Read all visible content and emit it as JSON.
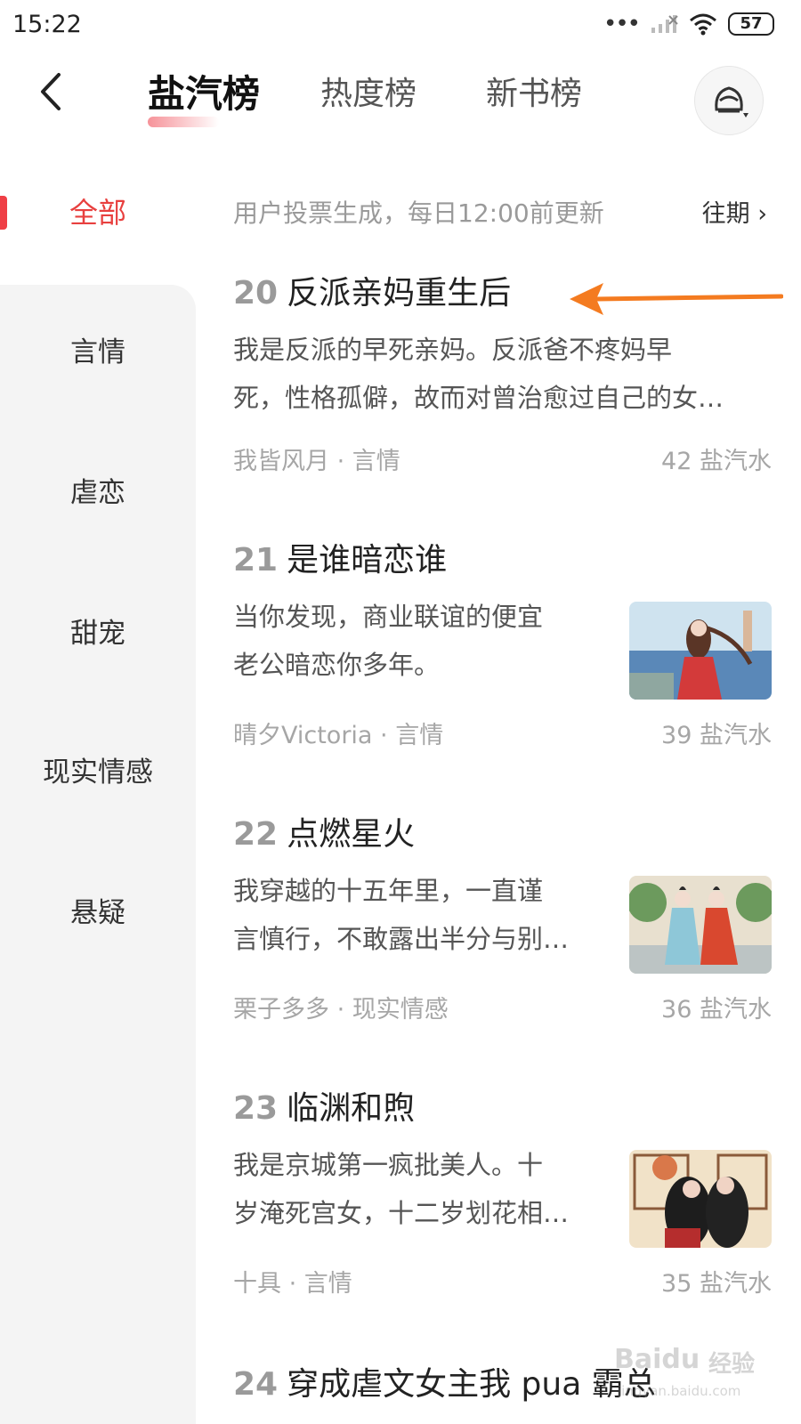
{
  "status": {
    "time": "15:22",
    "battery": "57"
  },
  "header": {
    "tabs": [
      {
        "label": "盐汽榜",
        "active": true
      },
      {
        "label": "热度榜",
        "active": false
      },
      {
        "label": "新书榜",
        "active": false
      }
    ]
  },
  "sidebar": {
    "items": [
      {
        "label": "全部",
        "active": true
      },
      {
        "label": "言情"
      },
      {
        "label": "虐恋"
      },
      {
        "label": "甜宠"
      },
      {
        "label": "现实情感"
      },
      {
        "label": "悬疑"
      }
    ]
  },
  "info": {
    "text": "用户投票生成，每日12:00前更新",
    "history": "往期 ›"
  },
  "books": [
    {
      "rank": "20",
      "title": "反派亲妈重生后",
      "desc_lines": [
        "我是反派的早死亲妈。反派爸不疼妈早",
        "死，性格孤僻，故而对曾治愈过自己的女…"
      ],
      "meta": "我皆风月 · 言情",
      "score": "42 盐汽水"
    },
    {
      "rank": "21",
      "title": "是谁暗恋谁",
      "desc_lines": [
        "当你发现，商业联谊的便宜",
        "老公暗恋你多年。"
      ],
      "meta": "晴夕Victoria · 言情",
      "score": "39 盐汽水"
    },
    {
      "rank": "22",
      "title": "点燃星火",
      "desc_lines": [
        "我穿越的十五年里，一直谨",
        "言慎行，不敢露出半分与别…"
      ],
      "meta": "栗子多多 · 现实情感",
      "score": "36 盐汽水"
    },
    {
      "rank": "23",
      "title": "临渊和煦",
      "desc_lines": [
        "我是京城第一疯批美人。十",
        "岁淹死宫女，十二岁划花相…"
      ],
      "meta": "十具 · 言情",
      "score": "35 盐汽水"
    },
    {
      "rank": "24",
      "title": "穿成虐文女主我 pua 霸总"
    }
  ],
  "watermark": {
    "brand": "Baidu",
    "cn": "经验",
    "url": "jingyan.baidu.com"
  },
  "colors": {
    "accent": "#e8403f",
    "arrow": "#f47b20",
    "sidebar_bg": "#f4f4f4"
  }
}
